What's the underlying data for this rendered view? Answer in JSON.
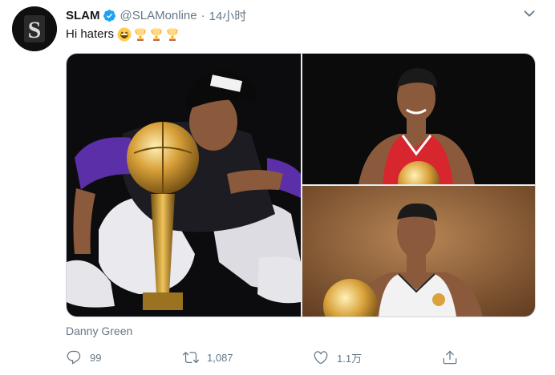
{
  "tweet": {
    "author": {
      "display_name": "SLAM",
      "handle": "@SLAMonline",
      "verified": true,
      "avatar_letter": "S"
    },
    "time": "14小时",
    "separator": "·",
    "text": "Hi haters",
    "emojis": [
      "grinning-face",
      "trophy",
      "trophy",
      "trophy"
    ],
    "media": {
      "photo_count": 3,
      "tagged_people": "Danny Green"
    },
    "actions": {
      "replies": "99",
      "retweets": "1,087",
      "likes": "1.1万",
      "share_icon": "share-icon"
    }
  },
  "colors": {
    "text_primary": "#14171a",
    "text_secondary": "#657786",
    "verified": "#1da1f2",
    "border": "#cfd9de"
  }
}
